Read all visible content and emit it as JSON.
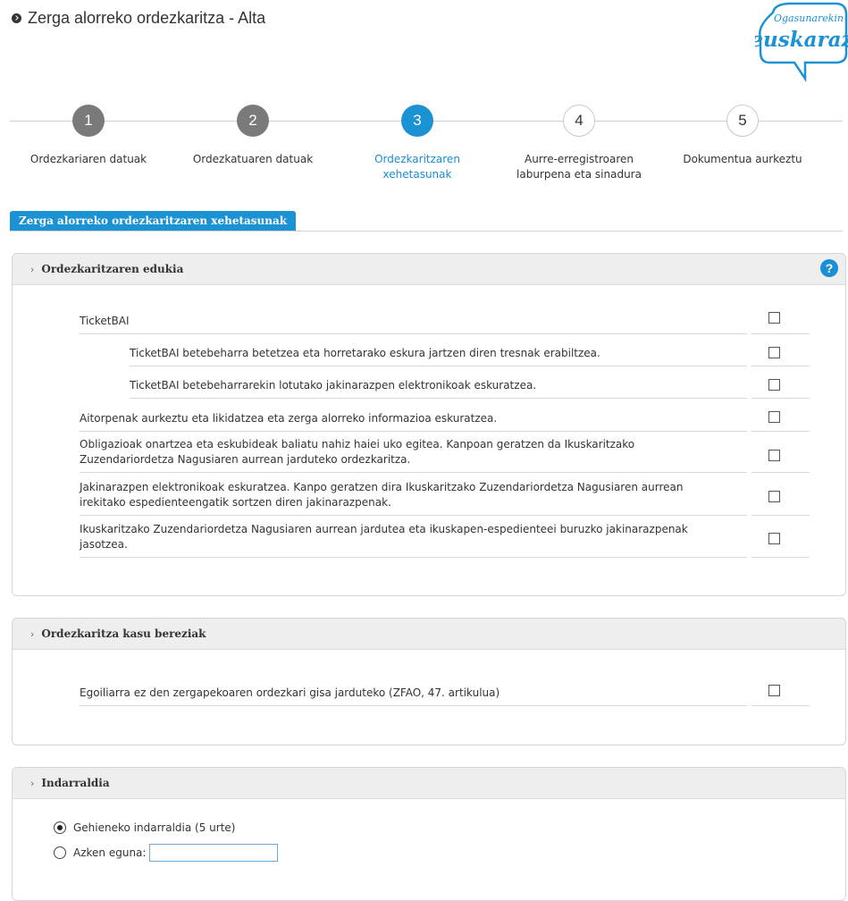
{
  "header": {
    "title": "Zerga alorreko ordezkaritza - Alta",
    "logo_text_top": "Ogasunarekin",
    "logo_text_main": "euskaraz"
  },
  "stepper": {
    "steps": [
      {
        "number": "1",
        "label_line1": "Ordezkariaren datuak",
        "label_line2": "",
        "state": "done"
      },
      {
        "number": "2",
        "label_line1": "Ordezkatuaren datuak",
        "label_line2": "",
        "state": "done"
      },
      {
        "number": "3",
        "label_line1": "Ordezkaritzaren",
        "label_line2": "xehetasunak",
        "state": "active"
      },
      {
        "number": "4",
        "label_line1": "Aurre-erregistroaren",
        "label_line2": "laburpena eta sinadura",
        "state": "todo"
      },
      {
        "number": "5",
        "label_line1": "Dokumentua aurkeztu",
        "label_line2": "",
        "state": "todo"
      }
    ]
  },
  "section_tab": "Zerga alorreko ordezkaritzaren xehetasunak",
  "panel_content": {
    "heading": "Ordezkaritzaren edukia",
    "help_icon": "?",
    "items": [
      {
        "line1": "TicketBAI",
        "line2": "",
        "checked": false
      },
      {
        "line1": "TicketBAI betebeharra betetzea eta horretarako eskura jartzen diren tresnak erabiltzea.",
        "line2": "",
        "checked": false
      },
      {
        "line1": "TicketBAI betebeharrarekin lotutako jakinarazpen elektronikoak eskuratzea.",
        "line2": "",
        "checked": false
      },
      {
        "line1": "Aitorpenak aurkeztu eta likidatzea eta zerga alorreko informazioa eskuratzea.",
        "line2": "",
        "checked": false
      },
      {
        "line1": "Obligazioak onartzea eta eskubideak baliatu nahiz haiei uko egitea. Kanpoan geratzen da Ikuskaritzako",
        "line2": "Zuzendariordetza Nagusiaren aurrean jarduteko ordezkaritza.",
        "checked": false
      },
      {
        "line1": "Jakinarazpen elektronikoak eskuratzea. Kanpo geratzen dira Ikuskaritzako Zuzendariordetza Nagusiaren aurrean",
        "line2": "irekitako espedienteengatik sortzen diren jakinarazpenak.",
        "checked": false
      },
      {
        "line1": "Ikuskaritzako Zuzendariordetza Nagusiaren aurrean jardutea eta ikuskapen-espedienteei buruzko jakinarazpenak",
        "line2": "jasotzea.",
        "checked": false
      }
    ]
  },
  "panel_special": {
    "heading": "Ordezkaritza kasu bereziak",
    "items": [
      {
        "line1": "Egoiliarra ez den zergapekoaren ordezkari gisa jarduteko (ZFAO, 47. artikulua)",
        "checked": false
      }
    ]
  },
  "panel_validity": {
    "heading": "Indarraldia",
    "option_max": "Gehieneko indarraldia (5 urte)",
    "option_last_day": "Azken eguna:",
    "selected": "max",
    "last_day_value": ""
  }
}
